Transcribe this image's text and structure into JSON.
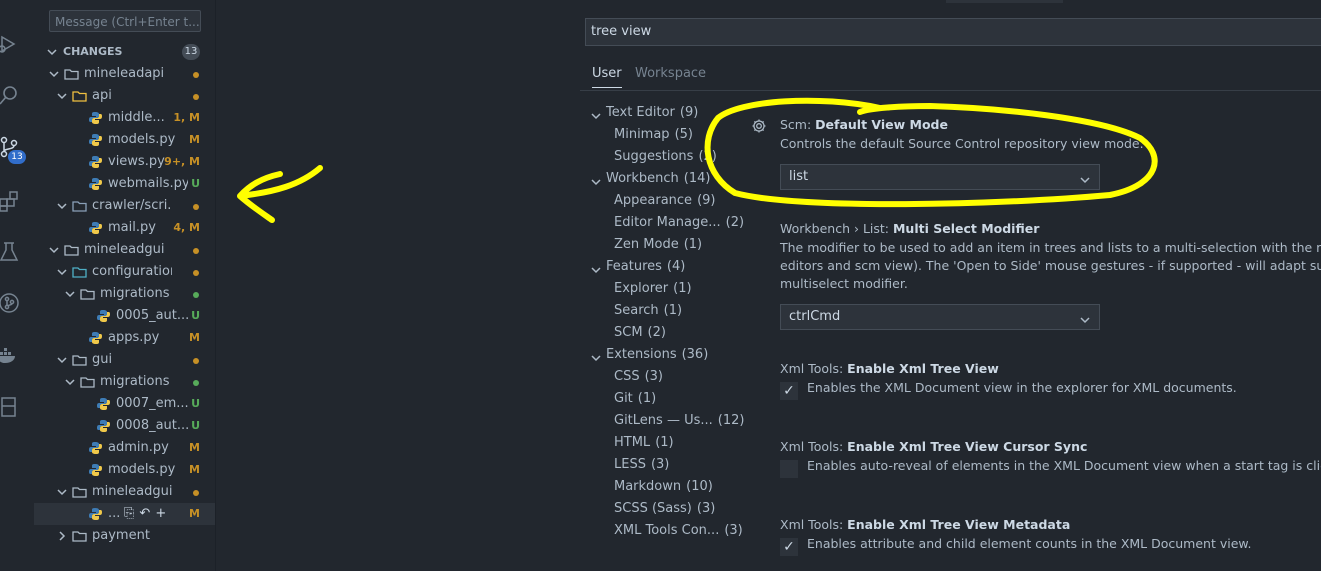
{
  "colors": {
    "accent": "#316dca",
    "modified": "#c69026",
    "untracked": "#57ab5a",
    "annotation": "#ffff00"
  },
  "activity_bar": {
    "icons": [
      "run-debug-icon",
      "search-icon",
      "source-control-icon",
      "extensions-icon",
      "testing-icon",
      "git-graph-icon",
      "docker-icon",
      "remote-explorer-icon"
    ],
    "scm_badge": "13"
  },
  "scm": {
    "message_placeholder": "Message (Ctrl+Enter t...",
    "changes_label": "CHANGES",
    "changes_count": "13",
    "tree": [
      {
        "label": "mineleadapi",
        "kind": "folder",
        "status": "",
        "dot": "#c69026"
      },
      {
        "label": "api",
        "kind": "folder",
        "status": "",
        "dot": "#c69026"
      },
      {
        "label": "middle...",
        "kind": "py",
        "status": "1, M",
        "color": "#c69026"
      },
      {
        "label": "models.py",
        "kind": "py",
        "status": "M",
        "color": "#c69026"
      },
      {
        "label": "views.py",
        "kind": "py",
        "status": "9+, M",
        "color": "#c69026"
      },
      {
        "label": "webmails.py",
        "kind": "py",
        "status": "U",
        "color": "#57ab5a"
      },
      {
        "label": "crawler/scri...",
        "kind": "folder",
        "status": "",
        "dot": "#c69026"
      },
      {
        "label": "mail.py",
        "kind": "py",
        "status": "4, M",
        "color": "#c69026"
      },
      {
        "label": "mineleadgui",
        "kind": "folder",
        "status": "",
        "dot": "#c69026"
      },
      {
        "label": "configuration",
        "kind": "folder",
        "status": "",
        "dot": "#c69026"
      },
      {
        "label": "migrations",
        "kind": "folder",
        "status": "",
        "dot": "#57ab5a"
      },
      {
        "label": "0005_aut...",
        "kind": "py",
        "status": "U",
        "color": "#57ab5a"
      },
      {
        "label": "apps.py",
        "kind": "py",
        "status": "M",
        "color": "#c69026"
      },
      {
        "label": "gui",
        "kind": "folder",
        "status": "",
        "dot": "#c69026"
      },
      {
        "label": "migrations",
        "kind": "folder",
        "status": "",
        "dot": "#57ab5a"
      },
      {
        "label": "0007_em...",
        "kind": "py",
        "status": "U",
        "color": "#57ab5a"
      },
      {
        "label": "0008_aut...",
        "kind": "py",
        "status": "U",
        "color": "#57ab5a"
      },
      {
        "label": "admin.py",
        "kind": "py",
        "status": "M",
        "color": "#c69026"
      },
      {
        "label": "models.py",
        "kind": "py",
        "status": "M",
        "color": "#c69026"
      },
      {
        "label": "mineleadgui",
        "kind": "folder",
        "status": "",
        "dot": "#c69026"
      },
      {
        "label": "...",
        "kind": "py",
        "status": "M",
        "color": "#c69026"
      },
      {
        "label": "payment",
        "kind": "folder",
        "status": "",
        "dot": ""
      }
    ]
  },
  "settings": {
    "search_value": "tree view",
    "tabs": [
      "User",
      "Workspace"
    ],
    "toc": [
      {
        "label": "Text Editor",
        "count": "(9)"
      },
      {
        "label": "Minimap",
        "count": "(5)"
      },
      {
        "label": "Suggestions",
        "count": "(2)"
      },
      {
        "label": "Workbench",
        "count": "(14)"
      },
      {
        "label": "Appearance",
        "count": "(9)"
      },
      {
        "label": "Editor Manage...",
        "count": "(2)"
      },
      {
        "label": "Zen Mode",
        "count": "(1)"
      },
      {
        "label": "Features",
        "count": "(4)"
      },
      {
        "label": "Explorer",
        "count": "(1)"
      },
      {
        "label": "Search",
        "count": "(1)"
      },
      {
        "label": "SCM",
        "count": "(2)"
      },
      {
        "label": "Extensions",
        "count": "(36)"
      },
      {
        "label": "CSS",
        "count": "(3)"
      },
      {
        "label": "Git",
        "count": "(1)"
      },
      {
        "label": "GitLens — Us...",
        "count": "(12)"
      },
      {
        "label": "HTML",
        "count": "(1)"
      },
      {
        "label": "LESS",
        "count": "(3)"
      },
      {
        "label": "Markdown",
        "count": "(10)"
      },
      {
        "label": "SCSS (Sass)",
        "count": "(3)"
      },
      {
        "label": "XML Tools Con...",
        "count": "(3)"
      }
    ],
    "items": [
      {
        "category": "Scm: ",
        "name": "Default View Mode",
        "desc": [
          "Controls the default Source Control repository view mode."
        ],
        "value": "list"
      },
      {
        "category": "Workbench › List: ",
        "name": "Multi Select Modifier",
        "desc": [
          "The modifier to be used to add an item in trees and lists to a multi-selection with the mouse",
          "editors and scm view). The 'Open to Side' mouse gestures - if supported - will adapt such that",
          "multiselect modifier."
        ],
        "value": "ctrlCmd"
      },
      {
        "category": "Xml Tools: ",
        "name": "Enable Xml Tree View",
        "desc": [
          "Enables the XML Document view in the explorer for XML documents."
        ],
        "checked": true
      },
      {
        "category": "Xml Tools: ",
        "name": "Enable Xml Tree View Cursor Sync",
        "desc": [
          "Enables auto-reveal of elements in the XML Document view when a start tag is clicked in"
        ],
        "checked": false
      },
      {
        "category": "Xml Tools: ",
        "name": "Enable Xml Tree View Metadata",
        "desc": [
          "Enables attribute and child element counts in the XML Document view."
        ],
        "checked": true
      }
    ]
  }
}
